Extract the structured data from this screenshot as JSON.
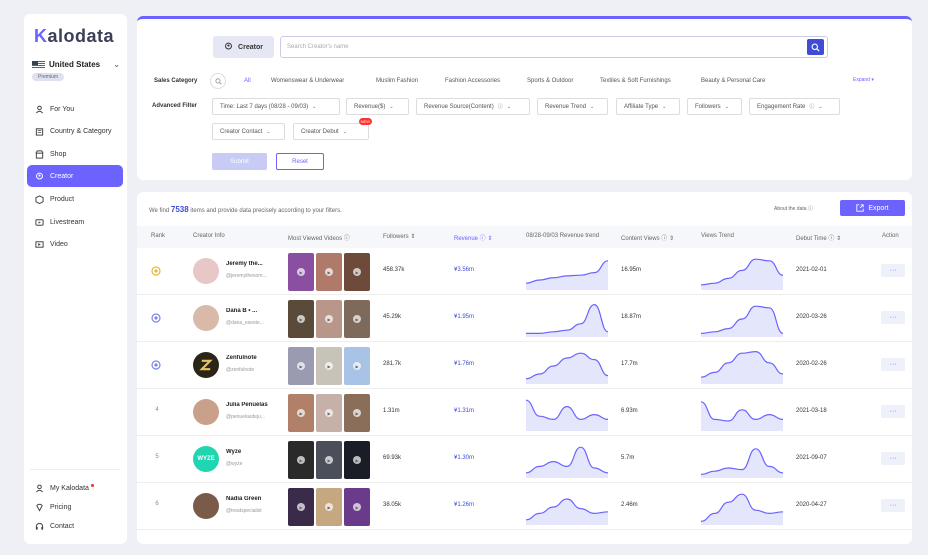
{
  "sidebar": {
    "logo_text": "Kalodata",
    "region": "United States",
    "badge": "Premium",
    "items": [
      {
        "label": "For You",
        "icon": "user-icon",
        "active": false
      },
      {
        "label": "Country & Category",
        "icon": "building-icon",
        "active": false
      },
      {
        "label": "Shop",
        "icon": "shop-icon",
        "active": false
      },
      {
        "label": "Creator",
        "icon": "creator-icon",
        "active": true
      },
      {
        "label": "Product",
        "icon": "box-icon",
        "active": false
      },
      {
        "label": "Livestream",
        "icon": "livestream-icon",
        "active": false
      },
      {
        "label": "Video",
        "icon": "video-icon",
        "active": false
      }
    ],
    "bottom_items": [
      {
        "label": "My Kalodata",
        "icon": "person-icon"
      },
      {
        "label": "Pricing",
        "icon": "diamond-icon"
      },
      {
        "label": "Contact",
        "icon": "headset-icon"
      }
    ]
  },
  "filter": {
    "tab_label": "Creator",
    "search_placeholder": "Search Creator's name",
    "sales_category_label": "Sales Category",
    "categories": [
      "All",
      "Womenswear & Underwear",
      "Muslim Fashion",
      "Fashion Accessories",
      "Sports & Outdoor",
      "Textiles & Soft Furnishings",
      "Beauty & Personal Care"
    ],
    "expand_label": "Expand",
    "advanced_label": "Advanced Filter",
    "advanced_filters": [
      "Time: Last 7 days (08/28 - 09/03)",
      "Revenue($)",
      "Revenue Source(Content)",
      "Revenue Trend",
      "Affiliate Type",
      "Followers",
      "Engagement Rate",
      "Creator Contact",
      "Creator Debut"
    ],
    "new_badge": "NEW",
    "submit_label": "Submit",
    "reset_label": "Reset"
  },
  "results": {
    "found_prefix": "We find",
    "count": "7538",
    "found_suffix": "items and provide data precisely according to your filters.",
    "about_label": "About the data",
    "export_label": "Export",
    "columns": [
      "Rank",
      "Creator Info",
      "Most Viewed Videos",
      "Followers",
      "Revenue",
      "08/28-09/03 Revenue trend",
      "Content Views",
      "Views Trend",
      "Debut Time",
      "Action"
    ],
    "rows": [
      {
        "rank": "1",
        "name": "Jeremy the...",
        "handle": "@jeremythesom...",
        "followers": "458.37k",
        "revenue": "¥3.56m",
        "views": "16.95m",
        "debut": "2021-02-01",
        "rev_trend": [
          0.15,
          0.25,
          0.32,
          0.38,
          0.4,
          0.48,
          0.85
        ],
        "view_trend": [
          0.1,
          0.15,
          0.3,
          0.55,
          0.9,
          0.85,
          0.4
        ]
      },
      {
        "rank": "2",
        "name": "Dana B • ...",
        "handle": "@dana_eseste...",
        "followers": "45.29k",
        "revenue": "¥1.95m",
        "views": "18.87m",
        "debut": "2020-03-26",
        "rev_trend": [
          0.05,
          0.05,
          0.1,
          0.15,
          0.35,
          0.95,
          0.1
        ],
        "view_trend": [
          0.05,
          0.1,
          0.2,
          0.5,
          0.9,
          0.85,
          0.05
        ]
      },
      {
        "rank": "3",
        "name": "Zenfulnote",
        "handle": "@zenfulnote",
        "followers": "281.7k",
        "revenue": "¥1.76m",
        "views": "17.7m",
        "debut": "2020-02-26",
        "rev_trend": [
          0.1,
          0.25,
          0.5,
          0.75,
          0.9,
          0.7,
          0.2
        ],
        "view_trend": [
          0.15,
          0.3,
          0.6,
          0.9,
          0.95,
          0.6,
          0.25
        ]
      },
      {
        "rank": "4",
        "name": "Julia Penuelas",
        "handle": "@penuelasdeju...",
        "followers": "1.31m",
        "revenue": "¥1.31m",
        "views": "6.93m",
        "debut": "2021-03-18",
        "rev_trend": [
          0.9,
          0.4,
          0.3,
          0.7,
          0.3,
          0.45,
          0.3
        ],
        "view_trend": [
          0.85,
          0.3,
          0.25,
          0.6,
          0.3,
          0.45,
          0.3
        ]
      },
      {
        "rank": "5",
        "name": "Wyze",
        "handle": "@wyze",
        "followers": "69.93k",
        "revenue": "¥1.30m",
        "views": "5.7m",
        "debut": "2021-09-07",
        "rev_trend": [
          0.1,
          0.3,
          0.45,
          0.3,
          0.9,
          0.25,
          0.1
        ],
        "view_trend": [
          0.05,
          0.15,
          0.25,
          0.2,
          0.85,
          0.3,
          0.1
        ]
      },
      {
        "rank": "6",
        "name": "Nadia Green",
        "handle": "@treatspecialist",
        "followers": "38.05k",
        "revenue": "¥1.26m",
        "views": "2.46m",
        "debut": "2020-04-27",
        "rev_trend": [
          0.1,
          0.3,
          0.5,
          0.75,
          0.45,
          0.3,
          0.35
        ],
        "view_trend": [
          0.05,
          0.3,
          0.65,
          0.9,
          0.4,
          0.3,
          0.35
        ]
      }
    ],
    "action_label": "···"
  },
  "colors": {
    "accent": "#6c63ff",
    "accent_dark": "#3f4dd6"
  }
}
